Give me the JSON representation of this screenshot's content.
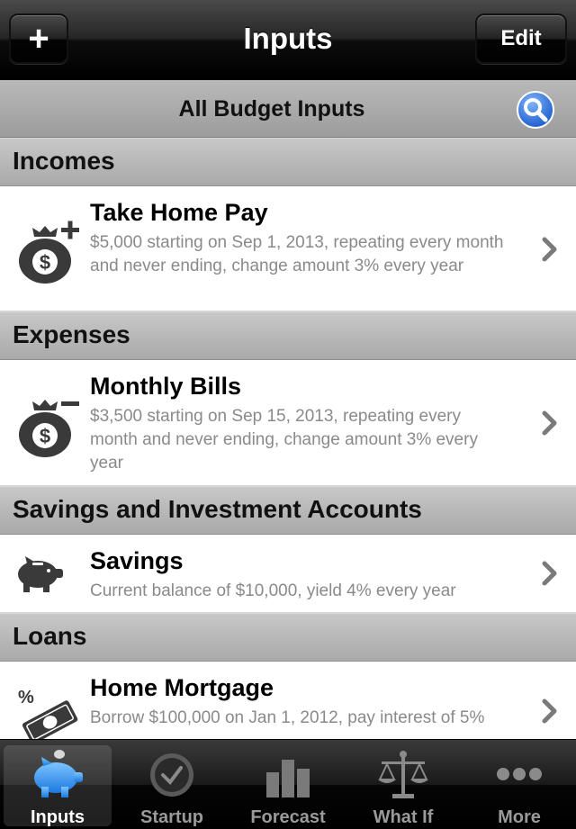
{
  "navbar": {
    "title": "Inputs",
    "add_label": "+",
    "edit_label": "Edit"
  },
  "search": {
    "title": "All Budget Inputs"
  },
  "sections": [
    {
      "header": "Incomes",
      "rows": [
        {
          "title": "Take Home Pay",
          "description": "$5,000 starting on Sep 1, 2013, repeating every month and never ending, change amount 3% every year",
          "icon": "money-bag-plus-icon"
        }
      ]
    },
    {
      "header": "Expenses",
      "rows": [
        {
          "title": "Monthly Bills",
          "description": "$3,500 starting on Sep 15, 2013, repeating every month and never ending, change amount 3% every year",
          "icon": "money-bag-minus-icon"
        }
      ]
    },
    {
      "header": "Savings and Investment Accounts",
      "rows": [
        {
          "title": "Savings",
          "description": "Current balance of $10,000, yield 4% every year",
          "icon": "piggy-bank-icon"
        }
      ]
    },
    {
      "header": "Loans",
      "rows": [
        {
          "title": "Home Mortgage",
          "description": "Borrow $100,000 on Jan 1, 2012, pay interest of 5%",
          "icon": "cash-percent-icon"
        }
      ]
    }
  ],
  "tabbar": {
    "active": "Inputs",
    "tabs": [
      {
        "label": "Inputs",
        "icon": "piggy-bank-icon"
      },
      {
        "label": "Startup",
        "icon": "clock-icon"
      },
      {
        "label": "Forecast",
        "icon": "bar-chart-icon"
      },
      {
        "label": "What If",
        "icon": "scales-icon"
      },
      {
        "label": "More",
        "icon": "more-dots-icon"
      }
    ]
  },
  "colors": {
    "accent_blue": "#2f7be0",
    "description_gray": "#8a8a8a",
    "section_gray": "#b4b4b4"
  }
}
